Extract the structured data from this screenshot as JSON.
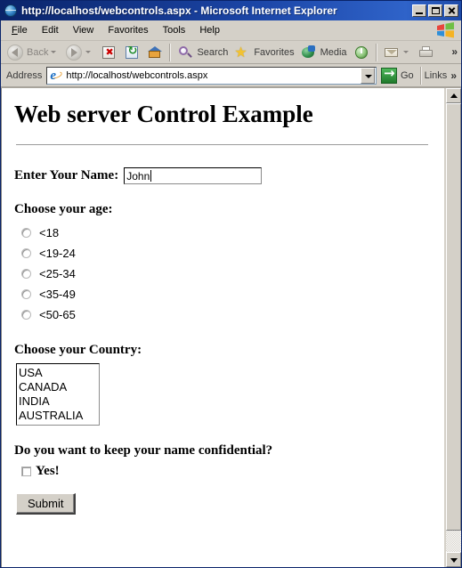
{
  "window": {
    "title": "http://localhost/webcontrols.aspx - Microsoft Internet Explorer",
    "icon": "ie-globe-icon",
    "minimize_label": "Minimize",
    "maximize_label": "Maximize",
    "close_label": "Close"
  },
  "menu": {
    "items": [
      {
        "label": "File",
        "accel": "F"
      },
      {
        "label": "Edit",
        "accel": "E"
      },
      {
        "label": "View",
        "accel": "V"
      },
      {
        "label": "Favorites",
        "accel": "a"
      },
      {
        "label": "Tools",
        "accel": "T"
      },
      {
        "label": "Help",
        "accel": "H"
      }
    ],
    "brand_icon": "windows-flag-icon"
  },
  "toolbar": {
    "back_label": "Back",
    "forward_label": "",
    "stop_label": "Stop",
    "refresh_label": "Refresh",
    "home_label": "Home",
    "search_label": "Search",
    "favorites_label": "Favorites",
    "media_label": "Media",
    "history_label": "History",
    "mail_label": "Mail",
    "print_label": "Print",
    "overflow_label": "»"
  },
  "address": {
    "label": "Address",
    "value": "http://localhost/webcontrols.aspx",
    "placeholder": "http://",
    "go_label": "Go",
    "links_label": "Links",
    "links_overflow": "»"
  },
  "page": {
    "title": "Web server Control Example",
    "name_field": {
      "label": "Enter Your Name:",
      "value": "John",
      "placeholder": ""
    },
    "age_group": {
      "heading": "Choose your age:",
      "options": [
        {
          "label": "<18",
          "selected": false
        },
        {
          "label": "<19-24",
          "selected": false
        },
        {
          "label": "<25-34",
          "selected": false
        },
        {
          "label": "<35-49",
          "selected": false
        },
        {
          "label": "<50-65",
          "selected": false
        }
      ]
    },
    "country_group": {
      "heading": "Choose your Country:",
      "options": [
        {
          "label": "USA",
          "selected": false
        },
        {
          "label": "CANADA",
          "selected": false
        },
        {
          "label": "INDIA",
          "selected": false
        },
        {
          "label": "AUSTRALIA",
          "selected": false
        }
      ]
    },
    "confidential_group": {
      "heading": "Do you want to keep your name confidential?",
      "checkbox_label": "Yes!",
      "checked": false
    },
    "submit_label": "Submit"
  },
  "colors": {
    "titlebar": "#0a246a",
    "chrome": "#d4d0c8",
    "page_background": "#ffffff",
    "text": "#000000",
    "go_button": "#2f8f3f"
  }
}
